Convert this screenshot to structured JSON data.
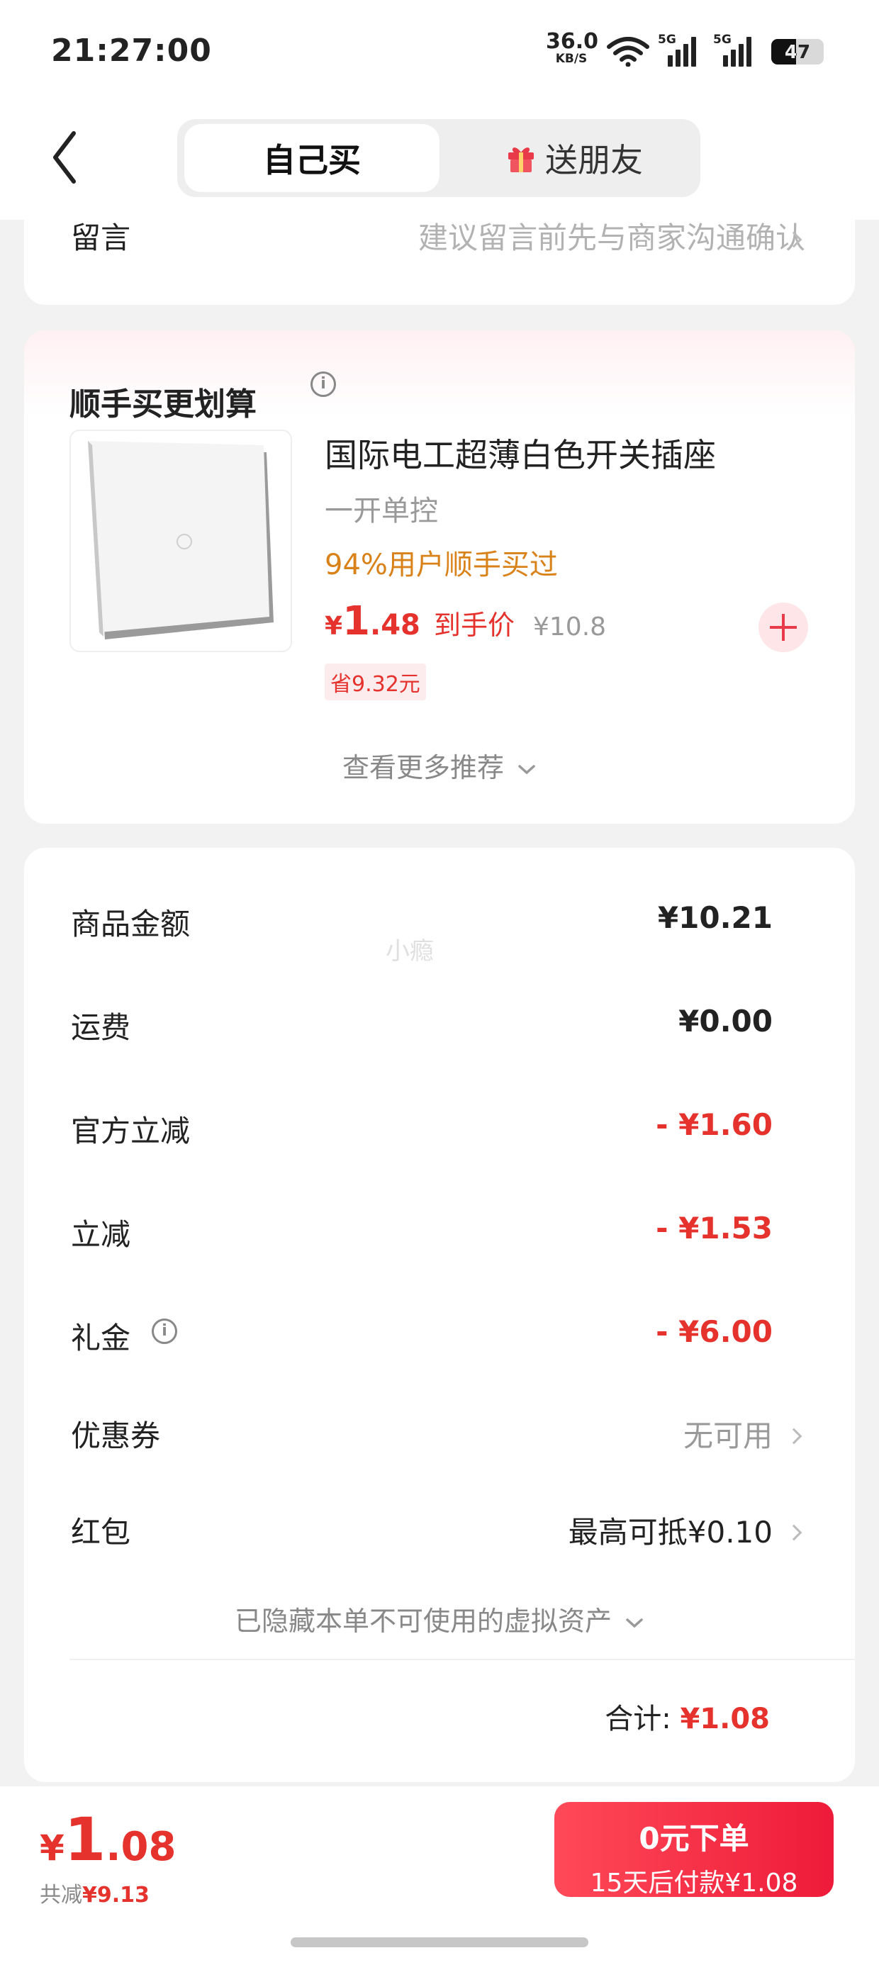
{
  "status_bar": {
    "time": "21:27:00",
    "net_speed": "36.0",
    "net_unit": "KB/S",
    "sig1": "5G",
    "sig2": "5G",
    "battery": "47"
  },
  "nav": {
    "tab_self": "自己买",
    "tab_gift": "送朋友"
  },
  "message": {
    "label": "留言",
    "placeholder": "建议留言前先与商家沟通确认"
  },
  "recommend": {
    "title": "顺手买更划算",
    "product_name": "国际电工超薄白色开关插座",
    "spec": "一开单控",
    "buy_rate": "94%用户顺手买过",
    "price_symbol": "¥",
    "price_int": "1",
    "price_dec": ".48",
    "price_tag": "到手价",
    "orig_price": "¥10.8",
    "save": "省9.32元",
    "more": "查看更多推荐"
  },
  "summary": {
    "watermark": "小瘾",
    "rows": [
      {
        "label": "商品金额",
        "value": "¥10.21"
      },
      {
        "label": "运费",
        "value": "¥0.00"
      },
      {
        "label": "官方立减",
        "value": "- ¥1.60"
      },
      {
        "label": "立减",
        "value": "- ¥1.53"
      },
      {
        "label": "礼金",
        "value": "- ¥6.00"
      },
      {
        "label": "优惠券",
        "value": "无可用"
      },
      {
        "label": "红包",
        "value": "最高可抵¥0.10"
      }
    ],
    "hidden_note": "已隐藏本单不可使用的虚拟资产",
    "total_label": "合计:",
    "total_value": "¥1.08"
  },
  "footer": {
    "currency": "¥",
    "pay_int": "1",
    "pay_dec": ".08",
    "saved_label": "共减",
    "saved_value": "¥9.13",
    "cta_title": "0元下单",
    "cta_sub": "15天后付款¥1.08"
  },
  "colors": {
    "accent_red": "#e5322d",
    "orange": "#d9821a",
    "cta_start": "#ff4958",
    "cta_end": "#ee1b39"
  }
}
